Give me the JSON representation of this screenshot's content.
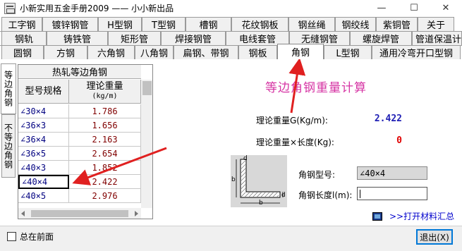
{
  "window": {
    "title": "小新实用五金手册2009 —— 小小新出品",
    "min_glyph": "—",
    "max_glyph": "☐",
    "close_glyph": "✕"
  },
  "tabs": {
    "row1": [
      "工字钢",
      "镀锌钢管",
      "H型钢",
      "T型钢",
      "槽钢",
      "花纹钢板",
      "钢丝绳",
      "钢绞线",
      "紫铜管",
      "关于"
    ],
    "row2": [
      "钢轨",
      "铸铁管",
      "矩形管",
      "焊接钢管",
      "电线套管",
      "无缝钢管",
      "螺旋焊管",
      "管道保温计算"
    ],
    "row3": [
      "圆钢",
      "方钢",
      "六角钢",
      "八角钢",
      "扁钢、带钢",
      "钢板",
      "角钢",
      "L型钢",
      "通用冷弯开口型钢"
    ],
    "active": "角钢"
  },
  "side_tabs": [
    "等边角钢",
    "不等边角钢"
  ],
  "table": {
    "caption": "热轧等边角钢",
    "col_spec": "型号规格",
    "col_weight": "理论重量",
    "col_weight_unit": "(kg/m)",
    "rows": [
      {
        "spec": "∠30×4",
        "weight": "1.786"
      },
      {
        "spec": "∠36×3",
        "weight": "1.656"
      },
      {
        "spec": "∠36×4",
        "weight": "2.163"
      },
      {
        "spec": "∠36×5",
        "weight": "2.654"
      },
      {
        "spec": "∠40×3",
        "weight": "1.852"
      },
      {
        "spec": "∠40×4",
        "weight": "2.422"
      },
      {
        "spec": "∠40×5",
        "weight": "2.976"
      }
    ],
    "selected_index": 5
  },
  "calc": {
    "title": "等边角钢重量计算",
    "weight_label": "理论重量G(Kg/m):",
    "weight_value": "2.422",
    "total_label": "理论重量×长度(Kg):",
    "total_value": "0",
    "spec_label": "角钢型号:",
    "spec_value": "∠40×4",
    "length_label": "角钢长度l(m):",
    "length_value": "",
    "export_label": ">>打开材料汇总",
    "diagram_labels": {
      "d_top": "d",
      "b_side": "b",
      "d_right": "d",
      "b_bottom": "b"
    }
  },
  "footer": {
    "always_on_top_label": "总在前面",
    "always_on_top_checked": false,
    "exit_label": "退出(X)"
  },
  "colors": {
    "accent_title": "#d633a3",
    "weight_value": "#1f1fb5",
    "total_value": "#e00000",
    "annotation_arrow": "#e02020"
  }
}
